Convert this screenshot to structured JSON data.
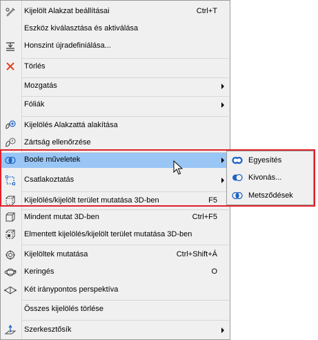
{
  "menu": {
    "items": [
      {
        "label": "Kijelölt Alakzat beállításai",
        "shortcut": "Ctrl+T",
        "icon": "object-settings-icon"
      },
      {
        "label": "Eszköz kiválasztása és aktiválása",
        "shortcut": "",
        "icon": ""
      },
      {
        "label": "Honszint újradefiniálása...",
        "shortcut": "",
        "icon": "home-story-icon"
      },
      {
        "label": "Törlés",
        "shortcut": "",
        "icon": "delete-icon"
      },
      {
        "label": "Mozgatás",
        "shortcut": "",
        "icon": "",
        "submenu": true
      },
      {
        "label": "Fóliák",
        "shortcut": "",
        "icon": "",
        "submenu": true
      },
      {
        "label": "Kijelölés Alakzattá alakítása",
        "shortcut": "",
        "icon": "convert-to-morph-icon"
      },
      {
        "label": "Zártság ellenőrzése",
        "shortcut": "",
        "icon": "check-solid-icon"
      },
      {
        "label": "Boole műveletek",
        "shortcut": "",
        "icon": "boolean-icon",
        "submenu": true
      },
      {
        "label": "Csatlakoztatás",
        "shortcut": "",
        "icon": "connect-icon",
        "submenu": true
      },
      {
        "label": "Kijelölés/kijelölt terület mutatása 3D-ben",
        "shortcut": "F5",
        "icon": "show-selection-3d-icon"
      },
      {
        "label": "Mindent mutat 3D-ben",
        "shortcut": "Ctrl+F5",
        "icon": "show-all-3d-icon"
      },
      {
        "label": "Elmentett kijelölés/kijelölt terület mutatása 3D-ben",
        "shortcut": "",
        "icon": "saved-selection-3d-icon"
      },
      {
        "label": "Kijelöltek mutatása",
        "shortcut": "Ctrl+Shift+Á",
        "icon": "show-selected-icon"
      },
      {
        "label": "Keringés",
        "shortcut": "O",
        "icon": "orbit-icon"
      },
      {
        "label": "Két iránypontos perspektíva",
        "shortcut": "",
        "icon": "two-point-perspective-icon"
      },
      {
        "label": "Összes kijelölés törlése",
        "shortcut": "",
        "icon": ""
      },
      {
        "label": "Szerkesztősík",
        "shortcut": "",
        "icon": "editing-plane-icon",
        "submenu": true
      }
    ]
  },
  "submenu": {
    "items": [
      {
        "label": "Egyesítés",
        "icon": "union-icon"
      },
      {
        "label": "Kivonás...",
        "icon": "subtract-icon"
      },
      {
        "label": "Metsződések",
        "icon": "intersect-icon"
      }
    ]
  },
  "colors": {
    "menu_bg": "#f0f0f0",
    "hover": "#99c6f5",
    "highlight_frame": "#e0202a",
    "icon_blue": "#1e63c6"
  }
}
